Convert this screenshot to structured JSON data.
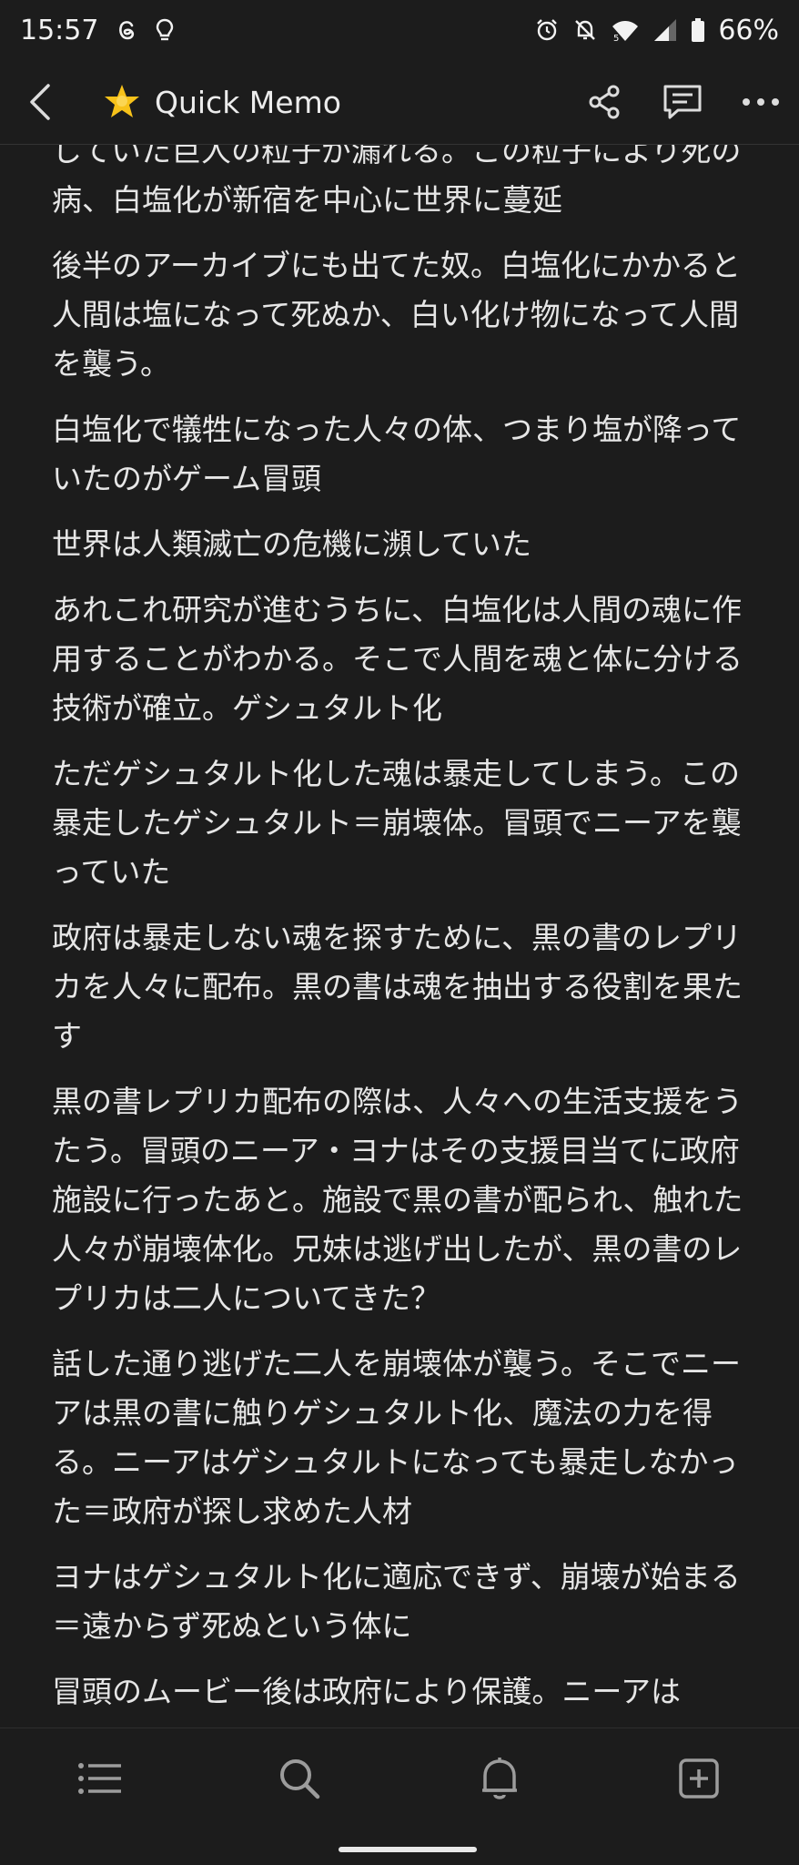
{
  "status": {
    "time": "15:57",
    "battery": "66%",
    "icons": [
      "threads-icon",
      "lightbulb-icon",
      "alarm-icon",
      "bell-off-icon",
      "wifi-icon",
      "signal-icon",
      "battery-icon"
    ]
  },
  "app_bar": {
    "title": "Quick Memo",
    "title_icon": "star-icon",
    "actions": [
      "share-icon",
      "comment-icon",
      "more-icon"
    ]
  },
  "memo": {
    "paragraphs": [
      "していた巨人の粒子が漏れる。この粒子により死の病、白塩化が新宿を中心に世界に蔓延",
      "後半のアーカイブにも出てた奴。白塩化にかかると人間は塩になって死ぬか、白い化け物になって人間を襲う。",
      "白塩化で犠牲になった人々の体、つまり塩が降っていたのがゲーム冒頭",
      "世界は人類滅亡の危機に瀕していた",
      "あれこれ研究が進むうちに、白塩化は人間の魂に作用することがわかる。そこで人間を魂と体に分ける技術が確立。ゲシュタルト化",
      "ただゲシュタルト化した魂は暴走してしまう。この暴走したゲシュタルト＝崩壊体。冒頭でニーアを襲っていた",
      "政府は暴走しない魂を探すために、黒の書のレプリカを人々に配布。黒の書は魂を抽出する役割を果たす",
      "黒の書レプリカ配布の際は、人々への生活支援をうたう。冒頭のニーア・ヨナはその支援目当てに政府施設に行ったあと。施設で黒の書が配られ、触れた人々が崩壊体化。兄妹は逃げ出したが、黒の書のレプリカは二人についてきた？",
      "話した通り逃げた二人を崩壊体が襲う。そこでニーアは黒の書に触りゲシュタルト化、魔法の力を得る。ニーアはゲシュタルトになっても暴走しなかった＝政府が探し求めた人材",
      "ヨナはゲシュタルト化に適応できず、崩壊が始まる＝遠からず死ぬという体に",
      "冒頭のムービー後は政府により保護。ニーアは"
    ]
  },
  "bottom_nav": {
    "items": [
      "list-icon",
      "search-icon",
      "bell-icon",
      "add-square-icon"
    ]
  },
  "colors": {
    "background": "#1c1c1c",
    "text": "#e6e6e6",
    "star": "#f7c21a"
  }
}
